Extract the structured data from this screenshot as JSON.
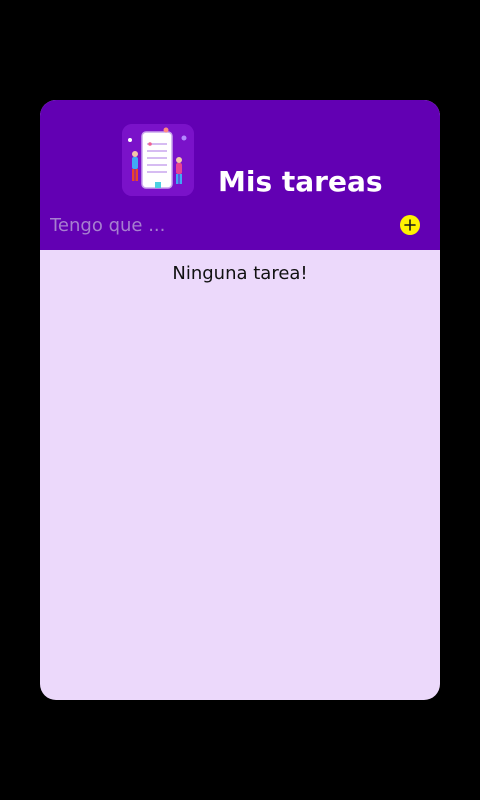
{
  "app": {
    "title": "Mis tareas",
    "logo_icon": "todo-list-illustration-icon"
  },
  "input": {
    "placeholder": "Tengo que ...",
    "value": ""
  },
  "add_button": {
    "icon": "plus-circle-icon"
  },
  "tasks": [],
  "empty_message": "Ninguna tarea!",
  "colors": {
    "background": "#000000",
    "header": "#6200b3",
    "content": "#ecd9fb",
    "accent": "#fff200",
    "title_text": "#ffffff",
    "placeholder_text": "#a77fd0"
  }
}
